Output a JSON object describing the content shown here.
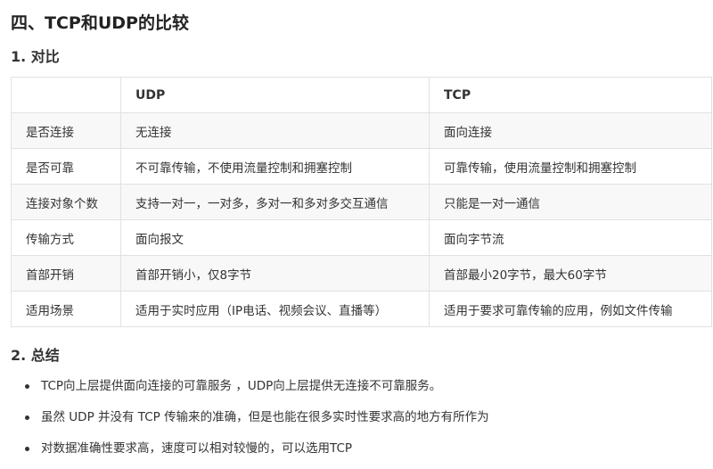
{
  "heading": "四、TCP和UDP的比较",
  "section1": {
    "title": "1. 对比"
  },
  "table": {
    "headers": [
      "",
      "UDP",
      "TCP"
    ],
    "rows": [
      [
        "是否连接",
        "无连接",
        "面向连接"
      ],
      [
        "是否可靠",
        "不可靠传输，不使用流量控制和拥塞控制",
        "可靠传输，使用流量控制和拥塞控制"
      ],
      [
        "连接对象个数",
        "支持一对一，一对多，多对一和多对多交互通信",
        "只能是一对一通信"
      ],
      [
        "传输方式",
        "面向报文",
        "面向字节流"
      ],
      [
        "首部开销",
        "首部开销小，仅8字节",
        "首部最小20字节，最大60字节"
      ],
      [
        "适用场景",
        "适用于实时应用（IP电话、视频会议、直播等）",
        "适用于要求可靠传输的应用，例如文件传输"
      ]
    ]
  },
  "section2": {
    "title": "2. 总结",
    "items": [
      "TCP向上层提供面向连接的可靠服务 ，UDP向上层提供无连接不可靠服务。",
      "虽然 UDP 并没有 TCP 传输来的准确，但是也能在很多实时性要求高的地方有所作为",
      "对数据准确性要求高，速度可以相对较慢的，可以选用TCP"
    ]
  }
}
